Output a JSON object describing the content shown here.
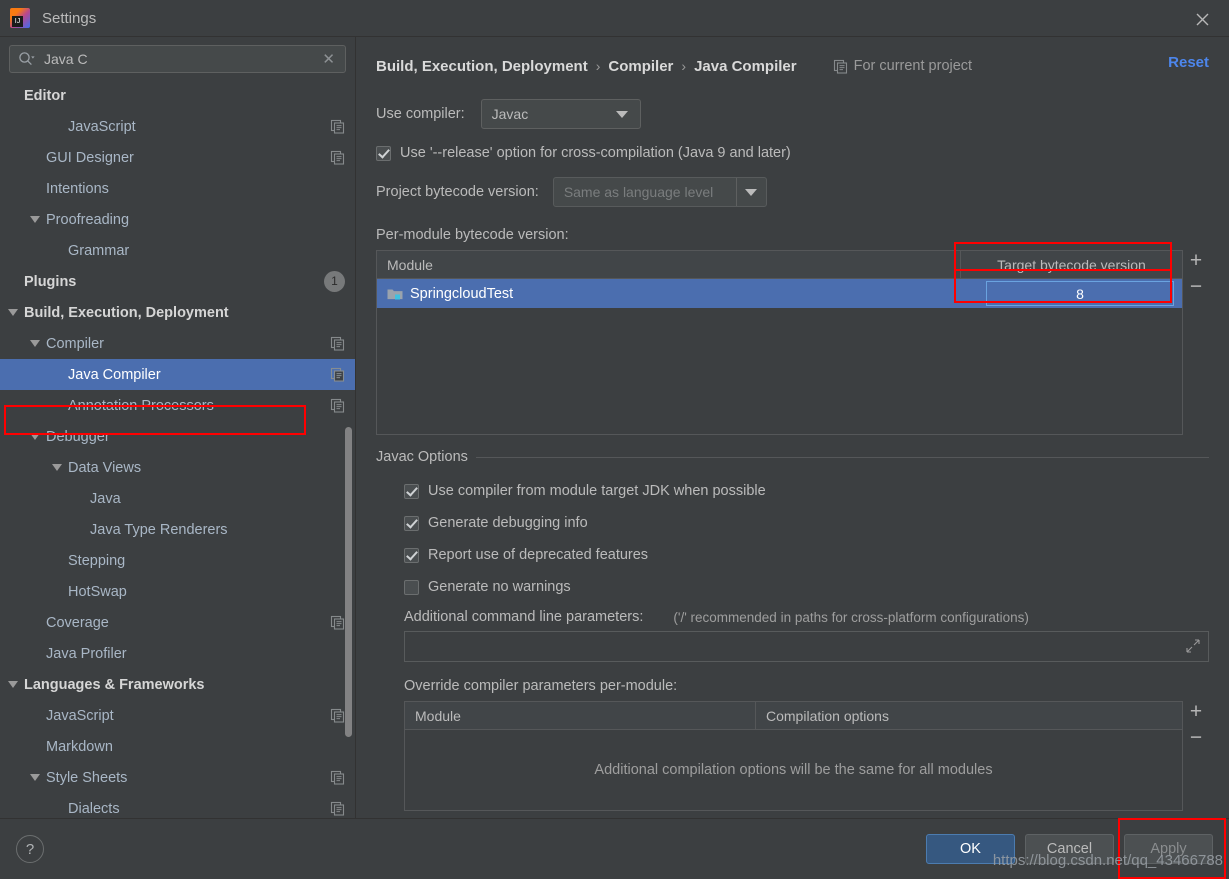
{
  "window": {
    "title": "Settings",
    "logo_icon": "intellij-idea-logo",
    "close_icon": "close-icon"
  },
  "search": {
    "value": "Java C",
    "icon": "search-icon",
    "clear_icon": "clear-icon"
  },
  "sidebar": {
    "scrollbar": "vertical-scrollbar",
    "items": [
      {
        "label": "Editor",
        "indent": 0,
        "bold": true,
        "arrow": false,
        "copy": false,
        "selected": false
      },
      {
        "label": "JavaScript",
        "indent": 2,
        "bold": false,
        "arrow": false,
        "copy": true,
        "selected": false
      },
      {
        "label": "GUI Designer",
        "indent": 1,
        "bold": false,
        "arrow": false,
        "copy": true,
        "selected": false
      },
      {
        "label": "Intentions",
        "indent": 1,
        "bold": false,
        "arrow": false,
        "copy": false,
        "selected": false
      },
      {
        "label": "Proofreading",
        "indent": 1,
        "bold": false,
        "arrow": true,
        "copy": false,
        "selected": false
      },
      {
        "label": "Grammar",
        "indent": 2,
        "bold": false,
        "arrow": false,
        "copy": false,
        "selected": false
      },
      {
        "label": "Plugins",
        "indent": 0,
        "bold": true,
        "arrow": false,
        "copy": false,
        "selected": false,
        "badge": "1"
      },
      {
        "label": "Build, Execution, Deployment",
        "indent": 0,
        "bold": true,
        "arrow": true,
        "copy": false,
        "selected": false
      },
      {
        "label": "Compiler",
        "indent": 1,
        "bold": false,
        "arrow": true,
        "copy": true,
        "selected": false
      },
      {
        "label": "Java Compiler",
        "indent": 2,
        "bold": false,
        "arrow": false,
        "copy": true,
        "selected": true
      },
      {
        "label": "Annotation Processors",
        "indent": 2,
        "bold": false,
        "arrow": false,
        "copy": true,
        "selected": false
      },
      {
        "label": "Debugger",
        "indent": 1,
        "bold": false,
        "arrow": true,
        "copy": false,
        "selected": false
      },
      {
        "label": "Data Views",
        "indent": 2,
        "bold": false,
        "arrow": true,
        "copy": false,
        "selected": false
      },
      {
        "label": "Java",
        "indent": 3,
        "bold": false,
        "arrow": false,
        "copy": false,
        "selected": false
      },
      {
        "label": "Java Type Renderers",
        "indent": 3,
        "bold": false,
        "arrow": false,
        "copy": false,
        "selected": false
      },
      {
        "label": "Stepping",
        "indent": 2,
        "bold": false,
        "arrow": false,
        "copy": false,
        "selected": false
      },
      {
        "label": "HotSwap",
        "indent": 2,
        "bold": false,
        "arrow": false,
        "copy": false,
        "selected": false
      },
      {
        "label": "Coverage",
        "indent": 1,
        "bold": false,
        "arrow": false,
        "copy": true,
        "selected": false
      },
      {
        "label": "Java Profiler",
        "indent": 1,
        "bold": false,
        "arrow": false,
        "copy": false,
        "selected": false
      },
      {
        "label": "Languages & Frameworks",
        "indent": 0,
        "bold": true,
        "arrow": true,
        "copy": false,
        "selected": false
      },
      {
        "label": "JavaScript",
        "indent": 1,
        "bold": false,
        "arrow": false,
        "copy": true,
        "selected": false
      },
      {
        "label": "Markdown",
        "indent": 1,
        "bold": false,
        "arrow": false,
        "copy": false,
        "selected": false
      },
      {
        "label": "Style Sheets",
        "indent": 1,
        "bold": false,
        "arrow": true,
        "copy": true,
        "selected": false
      },
      {
        "label": "Dialects",
        "indent": 2,
        "bold": false,
        "arrow": false,
        "copy": true,
        "selected": false
      }
    ]
  },
  "header": {
    "breadcrumb": [
      "Build, Execution, Deployment",
      "Compiler",
      "Java Compiler"
    ],
    "separator": "›",
    "scope_label": "For current project",
    "scope_icon": "copy-icon",
    "reset_label": "Reset"
  },
  "compiler": {
    "use_compiler_label": "Use compiler:",
    "use_compiler_value": "Javac",
    "release_option_label": "Use '--release' option for cross-compilation (Java 9 and later)",
    "release_option_checked": true,
    "project_bytecode_label": "Project bytecode version:",
    "project_bytecode_value": "Same as language level",
    "per_module_label": "Per-module bytecode version:"
  },
  "module_table": {
    "columns": [
      "Module",
      "Target bytecode version"
    ],
    "rows": [
      {
        "module": "SpringcloudTest",
        "target": "8",
        "icon": "module-folder-icon",
        "selected": true
      }
    ],
    "add_label": "+",
    "remove_label": "−"
  },
  "javac_options": {
    "legend": "Javac Options",
    "checkboxes": [
      {
        "label": "Use compiler from module target JDK when possible",
        "checked": true
      },
      {
        "label": "Generate debugging info",
        "checked": true
      },
      {
        "label": "Report use of deprecated features",
        "checked": true
      },
      {
        "label": "Generate no warnings",
        "checked": false
      }
    ],
    "params_label": "Additional command line parameters:",
    "params_hint": "('/' recommended in paths for cross-platform configurations)",
    "params_value": "",
    "expand_icon": "expand-icon"
  },
  "override_table": {
    "label": "Override compiler parameters per-module:",
    "columns": [
      "Module",
      "Compilation options"
    ],
    "empty_text": "Additional compilation options will be the same for all modules",
    "add_label": "+",
    "remove_label": "−"
  },
  "footer": {
    "help_label": "?",
    "ok_label": "OK",
    "cancel_label": "Cancel",
    "apply_label": "Apply"
  },
  "watermark": "https://blog.csdn.net/qq_43466788",
  "colors": {
    "selection_blue": "#4b6eaf",
    "accent_link": "#4d86ec",
    "annotation_red": "#ff0000",
    "primary_button": "#365880"
  }
}
